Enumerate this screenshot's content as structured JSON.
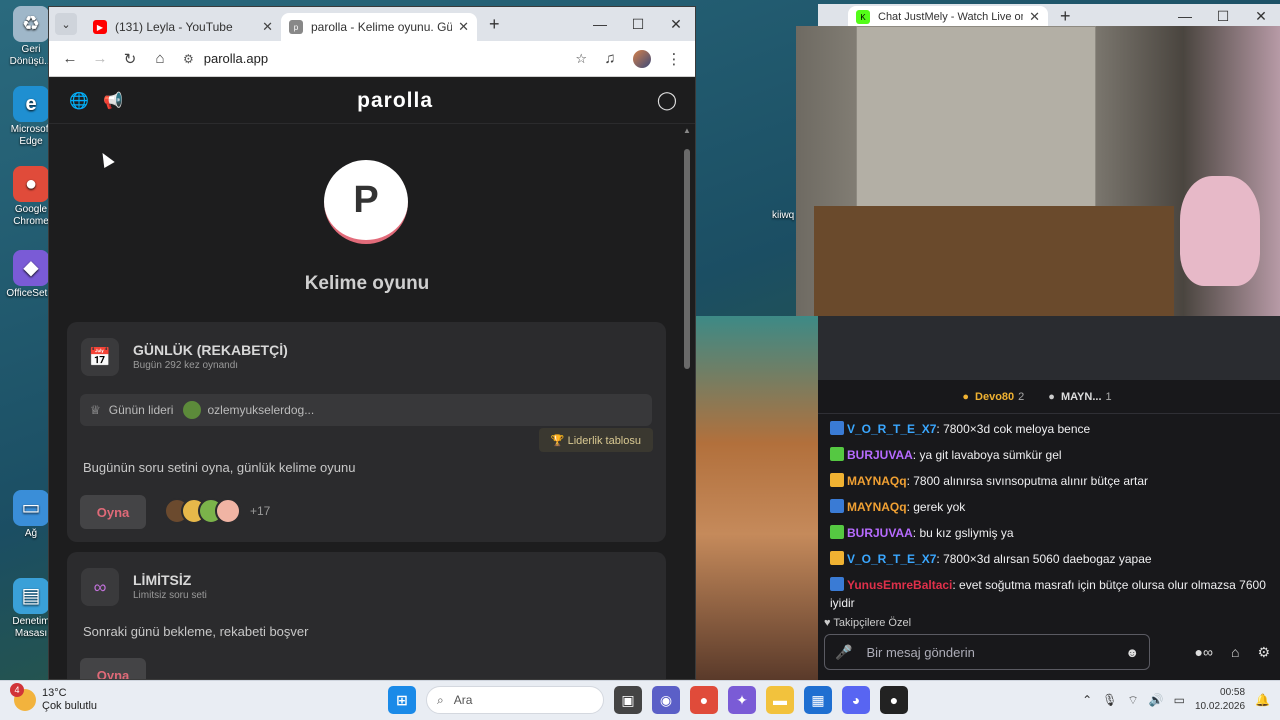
{
  "desktop": {
    "icons": [
      {
        "label": "Geri Dönüşü...",
        "glyph": "♻",
        "color": "#9fb7c9"
      },
      {
        "label": "Microsoft Edge",
        "glyph": "e",
        "color": "#1f8fd1"
      },
      {
        "label": "Google Chrome",
        "glyph": "●",
        "color": "#e04b3a"
      },
      {
        "label": "OfficeSet...",
        "glyph": "◆",
        "color": "#7a5bd6"
      },
      {
        "label": "Ağ",
        "glyph": "▭",
        "color": "#3a8ed8"
      },
      {
        "label": "Denetim Masası",
        "glyph": "▤",
        "color": "#3aa0d8"
      }
    ]
  },
  "left_browser": {
    "tabs": [
      {
        "title": "(131) Leyla - YouTube",
        "favicon": "youtube-icon",
        "color": "#ff0000"
      },
      {
        "title": "parolla - Kelime oyunu. Günlük",
        "favicon": "parolla-icon",
        "color": "#888888"
      }
    ],
    "url": "parolla.app",
    "app": {
      "brand": "parolla",
      "logo_letter": "P",
      "subtitle": "Kelime oyunu",
      "cards": {
        "daily": {
          "title": "GÜNLÜK (REKABETÇİ)",
          "subtitle": "Bugün 292 kez oynandı",
          "leader_label": "Günün lideri",
          "leader_name": "ozlemyukselerdog...",
          "leaderboard_button": "🏆 Liderlik tablosu",
          "description": "Bugünün soru setini oyna, günlük kelime oyunu",
          "play_button": "Oyna",
          "players_more": "+17"
        },
        "unlimited": {
          "title": "LİMİTSİZ",
          "subtitle": "Limitsiz soru seti",
          "description": "Sonraki günü bekleme, rekabeti boşver",
          "play_button": "Oyna"
        }
      }
    }
  },
  "right_browser": {
    "tab_title": "Chat JustMely - Watch Live on",
    "viewer_tag": "kiiwq",
    "chat": {
      "top_users": [
        {
          "name": "Devo80",
          "count": "2"
        },
        {
          "name": "MAYN...",
          "count": "1"
        }
      ],
      "messages": [
        {
          "user": "V_O_R_T_E_X7",
          "color": "#3aa7ff",
          "text": "7800×3d cok meloya bence"
        },
        {
          "user": "BURJUVAA",
          "color": "#b76bff",
          "text": "ya git lavaboya sümkür gel"
        },
        {
          "user": "MAYNAQq",
          "color": "#f0a033",
          "text": "7800 alınırsa sıvınsoputma alınır bütçe artar"
        },
        {
          "user": "MAYNAQq",
          "color": "#f0a033",
          "text": "gerek yok"
        },
        {
          "user": "BURJUVAA",
          "color": "#b76bff",
          "text": "bu kız gsliymiş ya"
        },
        {
          "user": "V_O_R_T_E_X7",
          "color": "#3aa7ff",
          "text": "7800×3d alırsan 5060 daebogaz yapae"
        },
        {
          "user": "YunusEmreBaltaci",
          "color": "#e0304a",
          "text": "evet soğutma masrafı için bütçe olursa olur olmazsa 7600 iyidir"
        }
      ],
      "follower_only": "Takipçilere Özel",
      "input_placeholder": "Bir mesaj gönderin"
    }
  },
  "taskbar": {
    "weather_temp": "13°C",
    "weather_desc": "Çok bulutlu",
    "weather_badge": "4",
    "search_placeholder": "Ara",
    "time": "00:58",
    "date": "10.02.2026"
  }
}
